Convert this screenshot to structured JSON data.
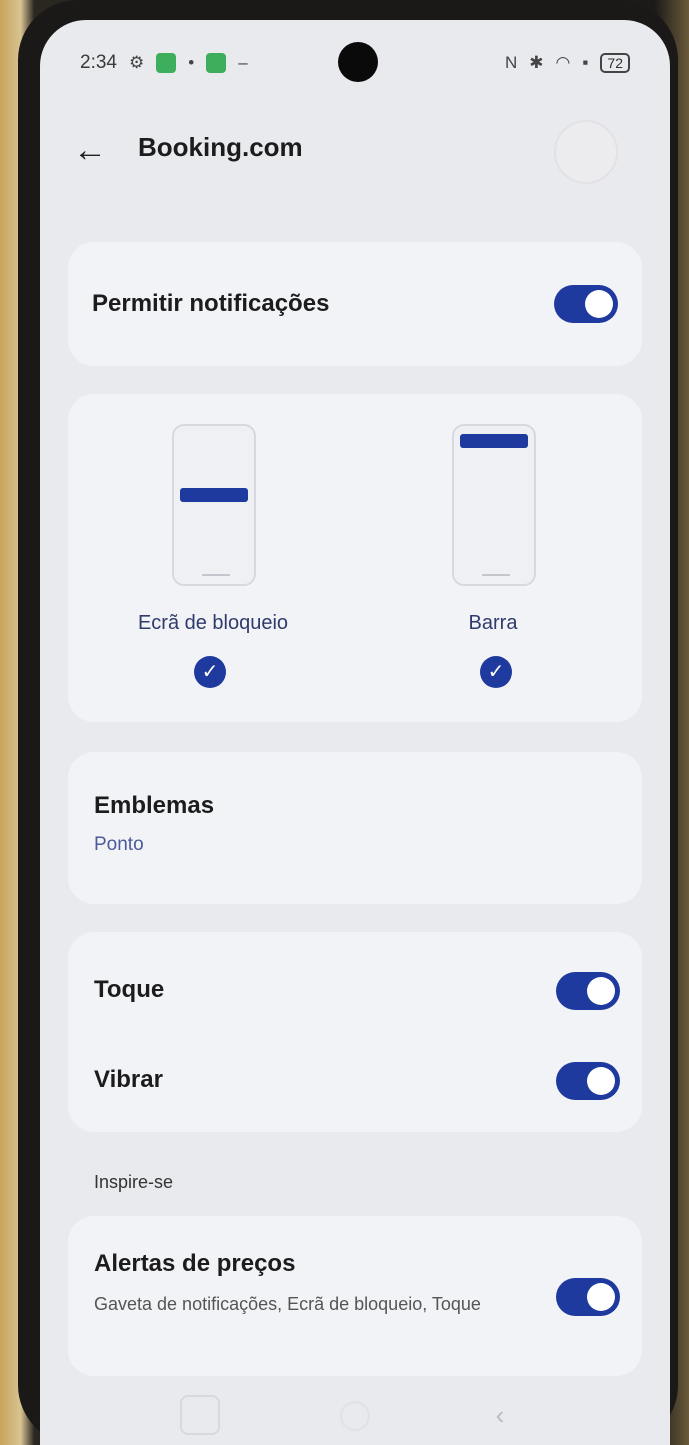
{
  "status_bar": {
    "time": "2:34",
    "battery": "72"
  },
  "header": {
    "title": "Booking.com"
  },
  "allow_notifications": {
    "label": "Permitir notificações",
    "enabled": true
  },
  "display_options": [
    {
      "label": "Ecrã de bloqueio",
      "checked": true
    },
    {
      "label": "Barra",
      "checked": true
    }
  ],
  "badges": {
    "title": "Emblemas",
    "value": "Ponto"
  },
  "sound": {
    "label": "Toque",
    "enabled": true
  },
  "vibrate": {
    "label": "Vibrar",
    "enabled": true
  },
  "section": {
    "title": "Inspire-se"
  },
  "price_alerts": {
    "title": "Alertas de preços",
    "description": "Gaveta de notificações, Ecrã de bloqueio, Toque",
    "enabled": true
  },
  "colors": {
    "accent": "#1f3a9e",
    "background": "#e9eaee",
    "card": "#f2f3f6"
  }
}
